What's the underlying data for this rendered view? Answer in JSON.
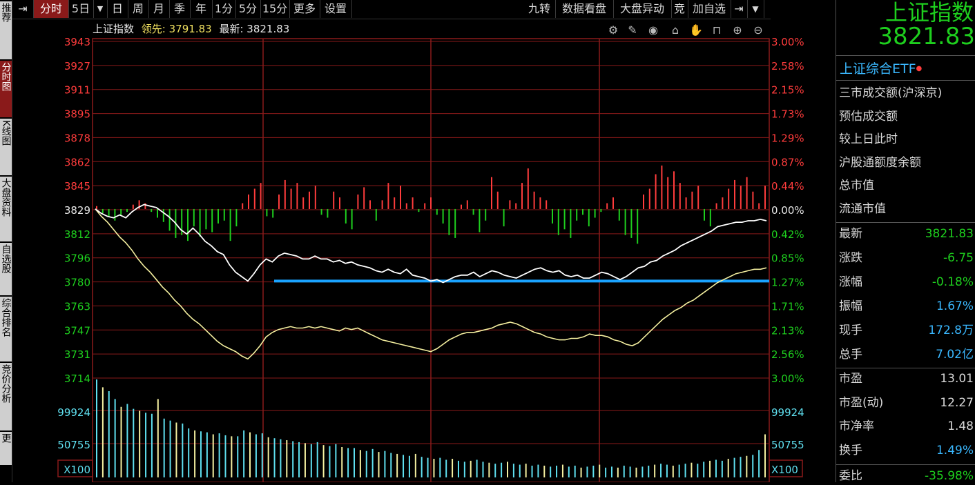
{
  "left_nav": [
    "推荐",
    "分时图",
    "K线图",
    "大盘资料",
    "自选股",
    "综合排名",
    "竞价分析",
    "更"
  ],
  "toolbar": {
    "left_buttons": [
      "分时",
      "5日",
      "日",
      "周",
      "月",
      "季",
      "年",
      "1分",
      "5分",
      "15分",
      "更多",
      "设置"
    ],
    "right_buttons": [
      "九转",
      "数据看盘",
      "大盘异动",
      "竞",
      "加自选"
    ]
  },
  "chart_header": {
    "name": "上证指数",
    "lead_label": "领先:",
    "lead_value": "3791.83",
    "latest_label": "最新:",
    "latest_value": "3821.83"
  },
  "y_axis_left": [
    "3943",
    "3927",
    "3911",
    "3895",
    "3878",
    "3862",
    "3845",
    "3829",
    "3812",
    "3796",
    "3780",
    "3763",
    "3747",
    "3731",
    "3714"
  ],
  "y_axis_right": [
    "3.00%",
    "2.58%",
    "2.15%",
    "1.73%",
    "1.29%",
    "0.87%",
    "0.44%",
    "0.00%",
    "0.42%",
    "0.85%",
    "1.27%",
    "1.71%",
    "2.13%",
    "2.56%",
    "3.00%"
  ],
  "volume_axis": {
    "left": [
      "99924",
      "50755",
      "X100"
    ],
    "right": [
      "99924",
      "50755",
      "X100"
    ]
  },
  "colors": {
    "up": "#ff3c3c",
    "down": "#1ecf1e",
    "price_line": "#ffffff",
    "avg_line": "#f5f0a0",
    "support_line": "#1aa3ff",
    "vol_cyan": "#5fe0f0",
    "vol_yellow": "#f5f0a0",
    "grid": "#8a1a1a"
  },
  "header_icons": [
    "gear-icon",
    "pen-icon",
    "eye-icon",
    "basket-icon",
    "hand-icon",
    "lock-icon",
    "zoom-in-icon",
    "zoom-out-icon"
  ],
  "right_panel": {
    "index_name": "上证指数",
    "index_price": "3821.83",
    "etf_link": "上证综合ETF",
    "info_items": [
      "三市成交额(沪深京)",
      "预估成交额",
      "较上日此时",
      "沪股通额度余额",
      "总市值",
      "流通市值"
    ],
    "quotes": [
      {
        "label": "最新",
        "value": "3821.83",
        "color": "#1ecf1e"
      },
      {
        "label": "涨跌",
        "value": "-6.75",
        "color": "#1ecf1e"
      },
      {
        "label": "涨幅",
        "value": "-0.18%",
        "color": "#1ecf1e"
      },
      {
        "label": "振幅",
        "value": "1.67%",
        "color": "#3ab8ff"
      },
      {
        "label": "现手",
        "value": "172.8万",
        "color": "#3ab8ff"
      },
      {
        "label": "总手",
        "value": "7.02亿",
        "color": "#3ab8ff"
      }
    ],
    "valuation": [
      {
        "label": "市盈",
        "value": "13.01",
        "color": "#d8d8d8"
      },
      {
        "label": "市盈(动)",
        "value": "12.27",
        "color": "#d8d8d8"
      },
      {
        "label": "市净率",
        "value": "1.48",
        "color": "#d8d8d8"
      },
      {
        "label": "换手",
        "value": "1.49%",
        "color": "#3ab8ff"
      }
    ],
    "weibi_label": "委比",
    "weibi_value": "-35.98%"
  },
  "chart_data": {
    "type": "line",
    "title": "上证指数",
    "y_range": [
      3714,
      3943
    ],
    "pre_close": 3829,
    "support_level": 3780,
    "price_series": [
      3829,
      3826,
      3824,
      3823,
      3825,
      3823,
      3827,
      3830,
      3832,
      3831,
      3830,
      3827,
      3824,
      3820,
      3815,
      3812,
      3816,
      3812,
      3807,
      3804,
      3800,
      3798,
      3791,
      3786,
      3783,
      3780,
      3785,
      3791,
      3795,
      3793,
      3797,
      3799,
      3798,
      3797,
      3795,
      3795,
      3797,
      3795,
      3795,
      3793,
      3794,
      3792,
      3793,
      3791,
      3790,
      3789,
      3787,
      3786,
      3788,
      3786,
      3785,
      3788,
      3784,
      3783,
      3782,
      3780,
      3781,
      3779,
      3781,
      3783,
      3784,
      3784,
      3786,
      3783,
      3785,
      3787,
      3786,
      3784,
      3783,
      3782,
      3784,
      3786,
      3788,
      3789,
      3787,
      3786,
      3787,
      3784,
      3783,
      3784,
      3782,
      3782,
      3784,
      3786,
      3785,
      3783,
      3781,
      3783,
      3786,
      3789,
      3790,
      3793,
      3794,
      3797,
      3799,
      3801,
      3804,
      3806,
      3808,
      3810,
      3812,
      3814,
      3817,
      3818,
      3819,
      3820,
      3820,
      3821,
      3821,
      3822,
      3821
    ],
    "avg_series": [
      3829,
      3824,
      3820,
      3815,
      3810,
      3806,
      3801,
      3795,
      3790,
      3786,
      3781,
      3776,
      3772,
      3767,
      3763,
      3758,
      3754,
      3751,
      3747,
      3743,
      3739,
      3736,
      3734,
      3732,
      3729,
      3727,
      3731,
      3736,
      3742,
      3745,
      3747,
      3748,
      3749,
      3748,
      3748,
      3749,
      3748,
      3749,
      3748,
      3747,
      3746,
      3748,
      3747,
      3748,
      3746,
      3744,
      3742,
      3740,
      3739,
      3738,
      3737,
      3736,
      3735,
      3734,
      3733,
      3732,
      3734,
      3737,
      3740,
      3742,
      3744,
      3745,
      3745,
      3746,
      3747,
      3748,
      3750,
      3751,
      3752,
      3751,
      3749,
      3747,
      3745,
      3744,
      3742,
      3741,
      3740,
      3740,
      3741,
      3741,
      3742,
      3744,
      3743,
      3743,
      3742,
      3740,
      3739,
      3737,
      3736,
      3738,
      3742,
      3746,
      3750,
      3754,
      3757,
      3760,
      3762,
      3765,
      3767,
      3770,
      3773,
      3776,
      3779,
      3781,
      3783,
      3785,
      3786,
      3787,
      3788,
      3788,
      3789
    ],
    "flow_series": [
      2,
      -3,
      -5,
      -8,
      -4,
      -2,
      3,
      6,
      4,
      -2,
      -6,
      -9,
      -15,
      -20,
      -18,
      -22,
      -12,
      -19,
      -14,
      -16,
      -10,
      -8,
      -22,
      -12,
      4,
      10,
      14,
      18,
      -5,
      -6,
      10,
      20,
      14,
      18,
      8,
      12,
      16,
      -4,
      -6,
      12,
      8,
      -10,
      -14,
      10,
      15,
      6,
      -8,
      6,
      18,
      8,
      16,
      4,
      8,
      -2,
      4,
      8,
      -4,
      -10,
      -18,
      -20,
      3,
      6,
      -4,
      -16,
      -8,
      22,
      12,
      -12,
      6,
      4,
      18,
      28,
      12,
      8,
      6,
      -10,
      -18,
      -14,
      -20,
      -8,
      -4,
      -12,
      -6,
      -2,
      4,
      8,
      -8,
      -18,
      -20,
      -24,
      10,
      14,
      24,
      30,
      22,
      26,
      18,
      8,
      12,
      16,
      -8,
      -12,
      4,
      8,
      14,
      20,
      16,
      22,
      12,
      4,
      16
    ],
    "volume_series": [
      100,
      92,
      88,
      80,
      72,
      75,
      70,
      68,
      66,
      65,
      80,
      60,
      58,
      56,
      55,
      50,
      48,
      47,
      46,
      44,
      45,
      43,
      42,
      42,
      48,
      46,
      44,
      45,
      41,
      40,
      39,
      38,
      37,
      36,
      35,
      34,
      36,
      33,
      32,
      34,
      31,
      30,
      30,
      28,
      27,
      29,
      26,
      27,
      25,
      24,
      23,
      22,
      24,
      21,
      20,
      19,
      20,
      18,
      19,
      17,
      16,
      17,
      18,
      16,
      15,
      14,
      15,
      16,
      14,
      13,
      14,
      12,
      13,
      12,
      11,
      12,
      13,
      11,
      12,
      10,
      11,
      12,
      13,
      10,
      11,
      10,
      12,
      11,
      10,
      11,
      12,
      13,
      14,
      13,
      12,
      13,
      14,
      15,
      14,
      16,
      17,
      18,
      17,
      19,
      20,
      21,
      22,
      23,
      28,
      44
    ],
    "vol_axis_ticks": [
      "99924",
      "50755"
    ],
    "vol_axis_unit": "X100"
  }
}
